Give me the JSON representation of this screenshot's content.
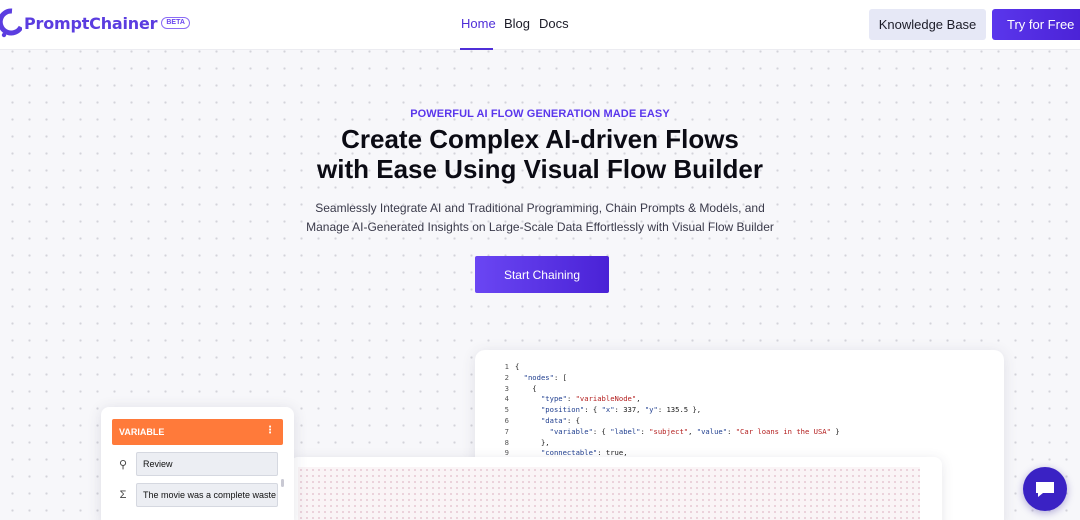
{
  "header": {
    "brand": "PromptChainer",
    "badge": "BETA",
    "nav": [
      {
        "label": "Home"
      },
      {
        "label": "Blog"
      },
      {
        "label": "Docs"
      }
    ],
    "knowledge_base_label": "Knowledge Base",
    "try_free_label": "Try for Free"
  },
  "hero": {
    "eyebrow": "POWERFUL AI FLOW GENERATION MADE EASY",
    "headline_line1": "Create Complex AI-driven Flows",
    "headline_line2": "with Ease Using Visual Flow Builder",
    "sub_line1": "Seamlessly Integrate AI and Traditional Programming, Chain Prompts & Models, and",
    "sub_line2": "Manage AI-Generated Insights on Large-Scale Data Effortlessly with Visual Flow Builder",
    "cta_label": "Start Chaining"
  },
  "code_preview": {
    "lines": [
      {
        "n": "1",
        "t": "{"
      },
      {
        "n": "2",
        "t": "  \"nodes\": ["
      },
      {
        "n": "3",
        "t": "    {"
      },
      {
        "n": "4",
        "t": "      \"type\": \"variableNode\","
      },
      {
        "n": "5",
        "t": "      \"position\": { \"x\": 337, \"y\": 135.5 },"
      },
      {
        "n": "6",
        "t": "      \"data\": {"
      },
      {
        "n": "7",
        "t": "        \"variable\": { \"label\": \"subject\", \"value\": \"Car loans in the USA\" }"
      },
      {
        "n": "8",
        "t": "      },"
      },
      {
        "n": "9",
        "t": "      \"connectable\": true,"
      }
    ]
  },
  "variable_node": {
    "title": "VARIABLE",
    "menu_glyph": "⋮",
    "rows": [
      {
        "icon": "⚲",
        "value": "Review"
      },
      {
        "icon": "Σ",
        "value": "The movie was a complete waste"
      }
    ]
  },
  "colors": {
    "accent": "#5a36ec",
    "variable_header": "#ff7a3a",
    "chat_bubble": "#3a22c4"
  }
}
